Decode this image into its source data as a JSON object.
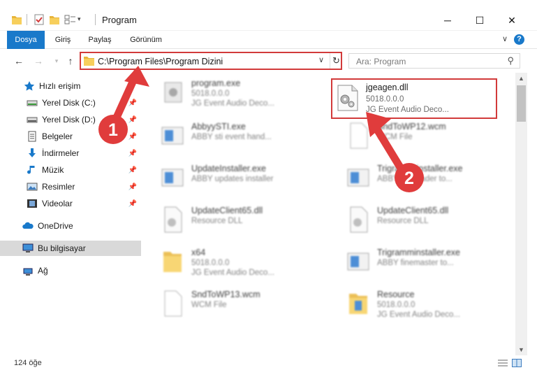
{
  "window": {
    "title": "Program",
    "minimize_glyph": "─",
    "maximize_glyph": "☐",
    "close_glyph": "✕"
  },
  "ribbon": {
    "tabs": [
      {
        "label": "Dosya",
        "active": true
      },
      {
        "label": "Giriş",
        "active": false
      },
      {
        "label": "Paylaş",
        "active": false
      },
      {
        "label": "Görünüm",
        "active": false
      }
    ],
    "help_label": "?"
  },
  "navigation": {
    "address_path": "C:\\Program Files\\Program Dizini",
    "search_placeholder": "Ara: Program"
  },
  "sidebar": {
    "items": [
      {
        "label": "Hızlı erişim",
        "icon": "star-icon"
      },
      {
        "label": "Yerel Disk (C:)",
        "icon": "drive-icon",
        "pinned": true
      },
      {
        "label": "Yerel Disk (D:)",
        "icon": "drive-icon",
        "pinned": true
      },
      {
        "label": "Belgeler",
        "icon": "documents-icon",
        "pinned": true
      },
      {
        "label": "İndirmeler",
        "icon": "downloads-icon",
        "pinned": true
      },
      {
        "label": "Müzik",
        "icon": "music-icon",
        "pinned": true
      },
      {
        "label": "Resimler",
        "icon": "pictures-icon",
        "pinned": true
      },
      {
        "label": "Videolar",
        "icon": "videos-icon",
        "pinned": true
      },
      {
        "label": "OneDrive",
        "icon": "cloud-icon"
      },
      {
        "label": "Bu bilgisayar",
        "icon": "computer-icon",
        "selected": true
      },
      {
        "label": "Ağ",
        "icon": "network-icon"
      }
    ]
  },
  "files": [
    {
      "name": "program.exe",
      "line1": "5018.0.0.0",
      "line2": "JG Event Audio Deco...",
      "icon": "exe-icon"
    },
    {
      "name": "jgeagen.dll",
      "line1": "5018.0.0.0",
      "line2": "JG Event Audio Deco...",
      "icon": "dll-icon",
      "highlighted": true
    },
    {
      "name": "AbbyySTI.exe",
      "line1": "ABBY sti event hand...",
      "line2": "",
      "icon": "app-icon"
    },
    {
      "name": "SndToWP12.wcm",
      "line1": "WCM File",
      "line2": "",
      "icon": "file-icon"
    },
    {
      "name": "UpdateInstaller.exe",
      "line1": "ABBY updates installer",
      "line2": "",
      "icon": "app-icon"
    },
    {
      "name": "Trigramm installer.exe",
      "line1": "ABBY finereader to...",
      "line2": "",
      "icon": "app-icon"
    },
    {
      "name": "UpdateClient65.dll",
      "line1": "Resource DLL",
      "line2": "",
      "icon": "dll-icon"
    },
    {
      "name": "UpdateClient65.dll",
      "line1": "Resource DLL",
      "line2": "",
      "icon": "dll-icon"
    },
    {
      "name": "x64",
      "line1": "5018.0.0.0",
      "line2": "JG Event Audio Deco...",
      "icon": "folder-icon"
    },
    {
      "name": "Trigramminstaller.exe",
      "line1": "ABBY finemaster to...",
      "line2": "",
      "icon": "app-icon"
    },
    {
      "name": "SndToWP13.wcm",
      "line1": "WCM File",
      "line2": "",
      "icon": "file-icon"
    },
    {
      "name": "Resource",
      "line1": "5018.0.0.0",
      "line2": "JG Event Audio Deco...",
      "icon": "folder-icon"
    }
  ],
  "status": {
    "item_count": "124 öğe"
  },
  "annotations": {
    "badge_1": "1",
    "badge_2": "2"
  },
  "colors": {
    "accent": "#1979ca",
    "highlight_red": "#d23a3a",
    "badge_red": "#e03c3c"
  }
}
